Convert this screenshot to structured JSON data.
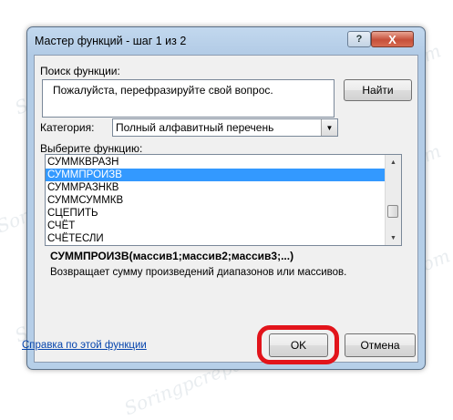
{
  "dialog": {
    "title": "Мастер функций - шаг 1 из 2",
    "help_button": "?",
    "close_button": "X"
  },
  "search": {
    "label": "Поиск функции:",
    "value": "Пожалуйста, перефразируйте свой вопрос.",
    "find_button": "Найти"
  },
  "category": {
    "label": "Категория:",
    "selected": "Полный алфавитный перечень"
  },
  "functions": {
    "label": "Выберите функцию:",
    "items": [
      "СУММКВРАЗН",
      "СУММПРОИЗВ",
      "СУММРАЗНКВ",
      "СУММСУММКВ",
      "СЦЕПИТЬ",
      "СЧЁТ",
      "СЧЁТЕСЛИ"
    ],
    "selected_index": 1
  },
  "selected_function": {
    "syntax": "СУММПРОИЗВ(массив1;массив2;массив3;...)",
    "description": "Возвращает сумму произведений диапазонов или массивов."
  },
  "footer": {
    "help_link": "Справка по этой функции",
    "ok_button": "OK",
    "cancel_button": "Отмена"
  },
  "watermark": "Soringpcrepair.com",
  "colors": {
    "selection": "#3399ff",
    "highlight_outline": "#e2141b",
    "link": "#0645ad"
  }
}
